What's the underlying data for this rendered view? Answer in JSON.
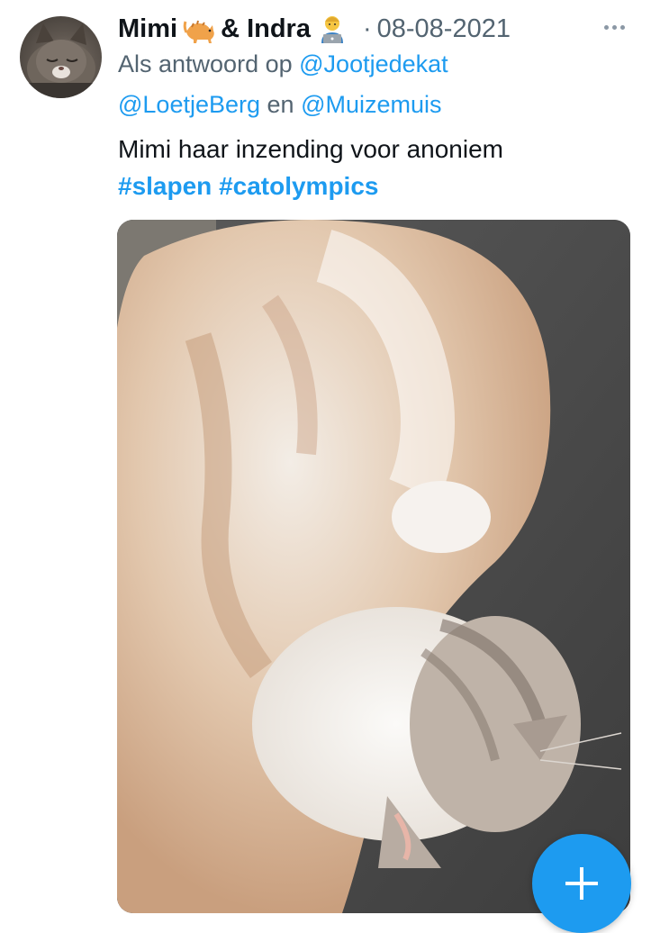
{
  "author": {
    "name": "Mimi",
    "joiner": "& Indra",
    "emoji_1": "cat-emoji",
    "emoji_2": "technologist-emoji",
    "separator": "·",
    "date": "08-08-2021"
  },
  "reply": {
    "prefix": "Als antwoord op",
    "mention_1": "@Jootjedekat",
    "mention_2": "@LoetjeBerg",
    "conjunction": "en",
    "mention_3": "@Muizemuis"
  },
  "text": {
    "line_1": "Mimi haar inzending voor anoniem",
    "hashtag_1": "#slapen",
    "hashtag_2": "#catolympics"
  },
  "media": {
    "image": "photo-sleeping-cat"
  },
  "icons": {
    "more": "more-icon",
    "compose": "plus-icon"
  },
  "colors": {
    "accent": "#1d9bf0",
    "secondary_text": "#536471",
    "primary_text": "#0f1419"
  }
}
